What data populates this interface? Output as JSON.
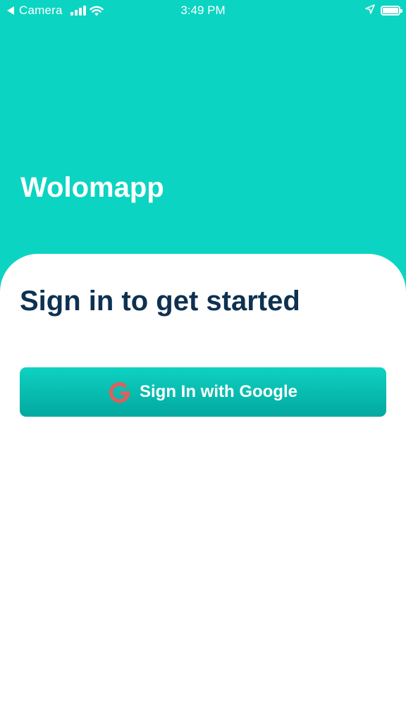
{
  "status_bar": {
    "back_app": "Camera",
    "time": "3:49 PM",
    "signal_bars": 4,
    "battery_level": 1.0,
    "icons": [
      "back-arrow-icon",
      "cellular-signal-icon",
      "wifi-icon",
      "location-arrow-icon",
      "battery-icon"
    ]
  },
  "header": {
    "app_name": "Wolomapp",
    "background_color": "#0cd4c2"
  },
  "signin": {
    "title": "Sign in to get started",
    "button_label": "Sign In with Google",
    "button_icon": "google-g-icon",
    "button_color": "#0cc3b4",
    "icon_color": "#e35d5b",
    "title_color": "#0e3151"
  }
}
